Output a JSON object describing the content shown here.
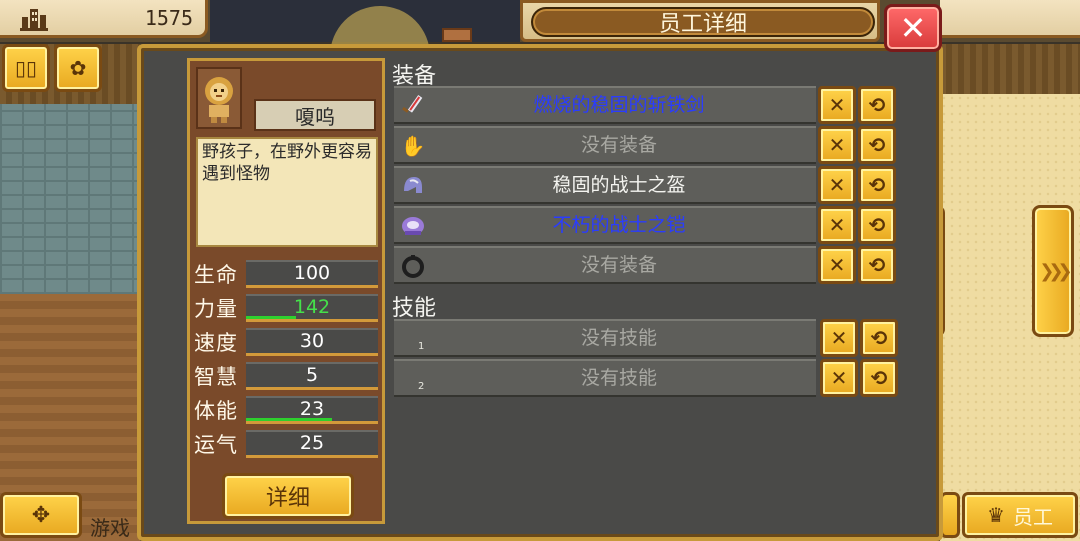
{
  "hud": {
    "money_icon": "building-icon",
    "money": "1575",
    "btn_pause_icon": "pause-icon",
    "btn_tools_icon": "gears-icon"
  },
  "dialog": {
    "title": "员工详细",
    "close_icon": "close-icon"
  },
  "character": {
    "name": "嗄呜",
    "portrait_icon": "lion-avatar-icon",
    "description": "野孩子，在野外更容易遇到怪物",
    "stats": [
      {
        "label": "生命",
        "value": "100",
        "bonus_fraction": 0
      },
      {
        "label": "力量",
        "value": "142",
        "bonus_fraction": 0.38,
        "highlight": true
      },
      {
        "label": "速度",
        "value": "30",
        "bonus_fraction": 0
      },
      {
        "label": "智慧",
        "value": "5",
        "bonus_fraction": 0
      },
      {
        "label": "体能",
        "value": "23",
        "bonus_fraction": 0.65
      },
      {
        "label": "运气",
        "value": "25",
        "bonus_fraction": 0
      }
    ],
    "detail_button": "详细"
  },
  "equipment": {
    "label": "装备",
    "slots": [
      {
        "icon": "sword-icon",
        "text": "燃烧的稳固的斩铁剑",
        "color": "blue"
      },
      {
        "icon": "glove-icon",
        "text": "没有装备",
        "color": "grey"
      },
      {
        "icon": "helmet-icon",
        "text": "稳固的战士之盔",
        "color": "white"
      },
      {
        "icon": "armor-icon",
        "text": "不朽的战士之铠",
        "color": "blue"
      },
      {
        "icon": "ring-icon",
        "text": "没有装备",
        "color": "grey"
      }
    ]
  },
  "skills": {
    "label": "技能",
    "slots": [
      {
        "index": "1",
        "text": "没有技能"
      },
      {
        "index": "2",
        "text": "没有技能"
      }
    ]
  },
  "bottom": {
    "game_label": "游戏",
    "staff_label": "员工"
  },
  "colors": {
    "gold": "#e8a820",
    "panel_brown": "#7a4a2a",
    "dialog_grey": "#4a4a48",
    "close_red": "#d83a3a",
    "item_blue": "#2a3cff",
    "bonus_green": "#2ed02e"
  }
}
